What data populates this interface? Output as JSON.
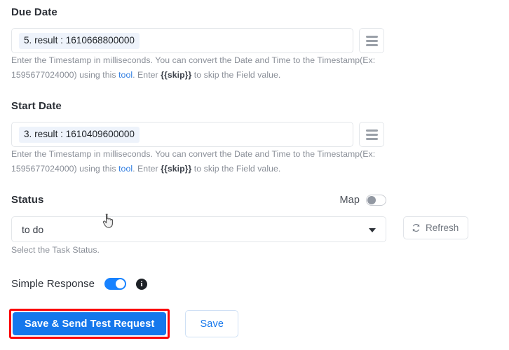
{
  "fields": [
    {
      "label": "Due Date",
      "value_token": "5. result : 1610668800000",
      "helper_part1": "Enter the Timestamp in milliseconds. You can convert the Date and Time to the Timestamp(Ex: 1595677024000) using this ",
      "helper_link": "tool",
      "helper_part2": ". Enter ",
      "helper_skip": "{{skip}}",
      "helper_part3": " to skip the Field value.",
      "menu_icon": "hamburger-menu-icon"
    },
    {
      "label": "Start Date",
      "value_token": "3. result : 1610409600000",
      "helper_part1": "Enter the Timestamp in milliseconds. You can convert the Date and Time to the Timestamp(Ex: 1595677024000) using this ",
      "helper_link": "tool",
      "helper_part2": ". Enter ",
      "helper_skip": "{{skip}}",
      "helper_part3": " to skip the Field value.",
      "menu_icon": "hamburger-menu-icon"
    }
  ],
  "status": {
    "label": "Status",
    "map_label": "Map",
    "map_toggle_state": "off",
    "selected_value": "to do",
    "caret_icon": "chevron-down-icon",
    "refresh_label": "Refresh",
    "refresh_icon": "refresh-icon",
    "helper": "Select the Task Status."
  },
  "simple_response": {
    "label": "Simple Response",
    "toggle_state": "on",
    "info_icon": "info-icon",
    "info_glyph": "i"
  },
  "footer": {
    "primary_label": "Save & Send Test Request",
    "secondary_label": "Save",
    "highlight_color": "#fb0007"
  },
  "cursor": {
    "type": "pointer-hand-cursor"
  },
  "colors": {
    "accent_blue": "#1577ec",
    "toggle_on": "#1782ff",
    "link_blue": "#2f7de1",
    "token_bg": "#eef3fb",
    "border": "#e3e6ea",
    "helper_text": "#8a8f98",
    "highlight_red": "#fb0007"
  }
}
